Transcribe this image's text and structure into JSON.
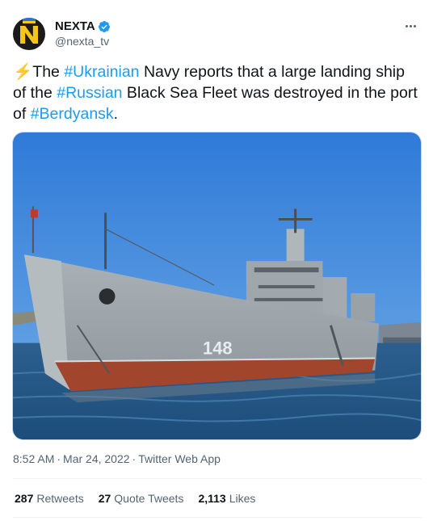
{
  "account": {
    "display_name": "NEXTA",
    "handle": "@nexta_tv"
  },
  "tweet": {
    "emoji": "⚡",
    "parts": {
      "t1": "The ",
      "tag1": "#Ukrainian",
      "t2": " Navy reports that a large landing ship of the ",
      "tag2": "#Russian",
      "t3": " Black Sea Fleet was destroyed in the port of ",
      "tag3": "#Berdyansk",
      "t4": "."
    }
  },
  "image": {
    "hull_number": "148"
  },
  "meta": {
    "time": "8:52 AM",
    "date": "Mar 24, 2022",
    "source": "Twitter Web App",
    "separator": "·"
  },
  "stats": {
    "retweets_count": "287",
    "retweets_label": "Retweets",
    "quotes_count": "27",
    "quotes_label": "Quote Tweets",
    "likes_count": "2,113",
    "likes_label": "Likes"
  },
  "colors": {
    "link": "#1d9bf0",
    "text": "#0f1419",
    "secondary": "#536471",
    "verified": "#1d9bf0"
  },
  "icons": [
    "verified-badge-icon",
    "more-options-icon",
    "lightning-emoji-icon"
  ]
}
